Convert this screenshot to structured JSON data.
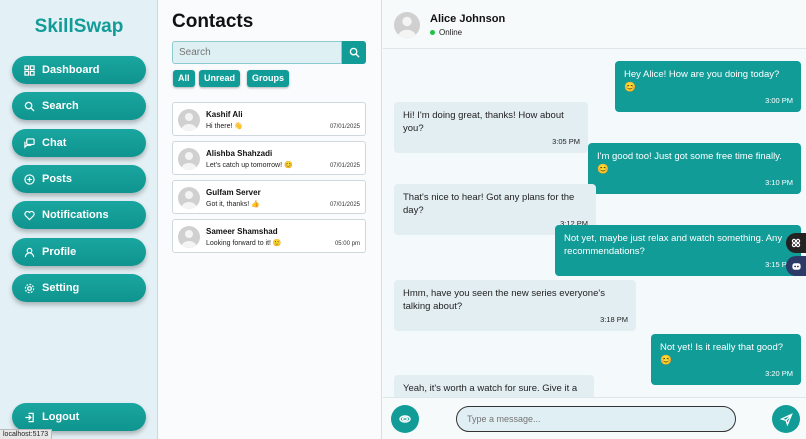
{
  "app": {
    "logo": "SkillSwap"
  },
  "sidebar": {
    "items": [
      {
        "label": "Dashboard",
        "icon": "grid-icon"
      },
      {
        "label": "Search",
        "icon": "search-icon"
      },
      {
        "label": "Chat",
        "icon": "chat-icon"
      },
      {
        "label": "Posts",
        "icon": "plus-circle-icon"
      },
      {
        "label": "Notifications",
        "icon": "heart-icon"
      },
      {
        "label": "Profile",
        "icon": "user-icon"
      },
      {
        "label": "Setting",
        "icon": "gear-icon"
      }
    ],
    "logout": "Logout"
  },
  "status_bar": {
    "url": "localhost:5173"
  },
  "contacts": {
    "title": "Contacts",
    "search_placeholder": "Search",
    "filters": [
      "All",
      "Unread",
      "Groups"
    ],
    "list": [
      {
        "name": "Kashif Ali",
        "last": "Hi there! 👋",
        "date": "07/01/2025"
      },
      {
        "name": "Alishba Shahzadi",
        "last": "Let's catch up tomorrow! 😊",
        "date": "07/01/2025"
      },
      {
        "name": "Gulfam Server",
        "last": "Got it, thanks! 👍",
        "date": "07/01/2025"
      },
      {
        "name": "Sameer Shamshad",
        "last": "Looking forward to it! 🙂",
        "date": "05:00 pm"
      }
    ]
  },
  "chat": {
    "contact_name": "Alice Johnson",
    "status": "Online",
    "messages": [
      {
        "dir": "out",
        "text": "Hey Alice! How are you doing today? 😊",
        "time": "3:00 PM"
      },
      {
        "dir": "in",
        "text": "Hi! I'm doing great, thanks! How about you?",
        "time": "3:05 PM"
      },
      {
        "dir": "out",
        "text": "I'm good too! Just got some free time finally. 😊",
        "time": "3:10 PM"
      },
      {
        "dir": "in",
        "text": "That's nice to hear! Got any plans for the day?",
        "time": "3:12 PM"
      },
      {
        "dir": "out",
        "text": "Not yet, maybe just relax and watch something. Any recommendations?",
        "time": "3:15 PM"
      },
      {
        "dir": "in",
        "text": "Hmm, have you seen the new series everyone's talking about?",
        "time": "3:18 PM"
      },
      {
        "dir": "out",
        "text": "Not yet! Is it really that good? 😊",
        "time": "3:20 PM"
      },
      {
        "dir": "in",
        "text": "Yeah, it's worth a watch for sure. Give it a try!",
        "time": ""
      }
    ],
    "input_placeholder": "Type a message..."
  },
  "colors": {
    "accent": "#129c98",
    "online": "#1fc24a"
  }
}
